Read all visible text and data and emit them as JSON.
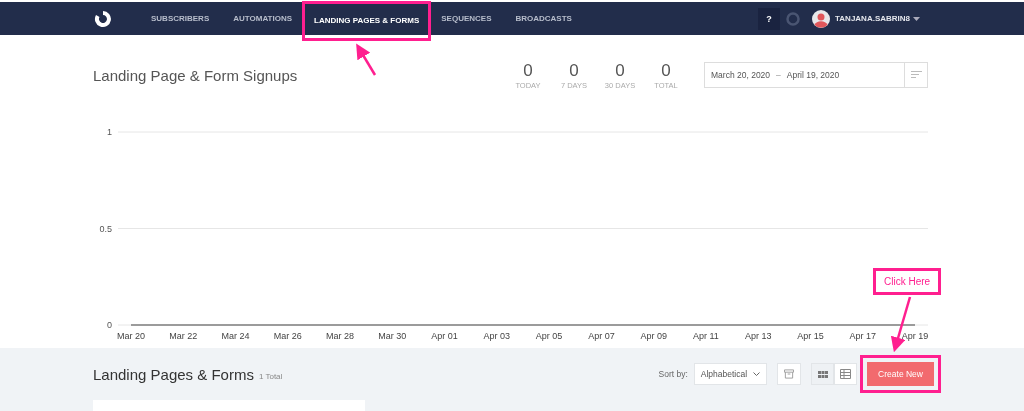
{
  "nav": {
    "items": [
      {
        "label": "SUBSCRIBERS",
        "selected": false,
        "highlighted": false
      },
      {
        "label": "AUTOMATIONS",
        "selected": false,
        "highlighted": false
      },
      {
        "label": "LANDING PAGES & FORMS",
        "selected": true,
        "highlighted": true
      },
      {
        "label": "SEQUENCES",
        "selected": false,
        "highlighted": false
      },
      {
        "label": "BROADCASTS",
        "selected": false,
        "highlighted": false
      }
    ],
    "help": "?",
    "user": "TANJANA.SABRIN8"
  },
  "signups": {
    "title": "Landing Page & Form Signups",
    "stats": [
      {
        "value": "0",
        "label": "TODAY"
      },
      {
        "value": "0",
        "label": "7 DAYS"
      },
      {
        "value": "0",
        "label": "30 DAYS"
      },
      {
        "value": "0",
        "label": "TOTAL"
      }
    ],
    "date_range": {
      "start": "March 20, 2020",
      "separator": "–",
      "end": "April 19, 2020"
    },
    "chart_data": {
      "type": "line",
      "categories": [
        "Mar 20",
        "Mar 22",
        "Mar 24",
        "Mar 26",
        "Mar 28",
        "Mar 30",
        "Apr 01",
        "Apr 03",
        "Apr 05",
        "Apr 07",
        "Apr 09",
        "Apr 11",
        "Apr 13",
        "Apr 15",
        "Apr 17",
        "Apr 19"
      ],
      "series": [
        {
          "color": "#9b9b9b",
          "values": [
            0,
            0,
            0,
            0,
            0,
            0,
            0,
            0,
            0,
            0,
            0,
            0,
            0,
            0,
            0,
            0
          ]
        }
      ],
      "ylim": [
        0,
        1
      ],
      "yticks": [
        0,
        0.5,
        1
      ]
    }
  },
  "list": {
    "title": "Landing Pages & Forms",
    "count": "1 Total",
    "sort_label": "Sort by:",
    "sort_value": "Alphabetical",
    "views": [
      {
        "kind": "grid",
        "selected": true
      },
      {
        "kind": "table",
        "selected": false
      }
    ],
    "create": {
      "label": "Create New",
      "highlighted": true
    }
  },
  "annotation": {
    "callout": "Click Here"
  }
}
